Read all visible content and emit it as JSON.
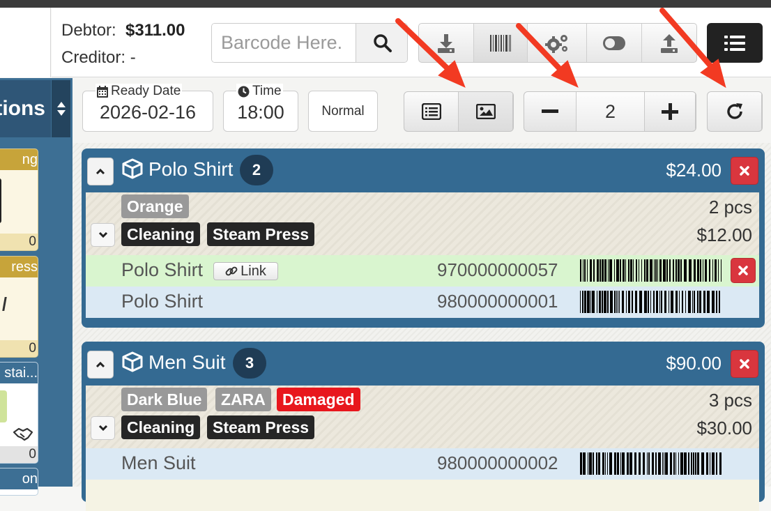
{
  "account": {
    "debtor_label": "Debtor:",
    "debtor_value": "$311.00",
    "creditor_label": "Creditor:",
    "creditor_value": "-"
  },
  "search": {
    "placeholder": "Barcode Here."
  },
  "toolbar": {
    "buttons": [
      "download-icon",
      "barcode-icon",
      "gears-icon",
      "toggle-icon",
      "upload-icon"
    ],
    "menu_icon": "list-icon"
  },
  "sidebar": {
    "header_label": "tions",
    "cards": [
      {
        "header": "ng",
        "footer": "0",
        "header_color": "#c7a43a"
      },
      {
        "header": "ress",
        "footer": "0",
        "header_color": "#c7a43a"
      },
      {
        "header": "stai...",
        "footer": "0",
        "header_color": "#3d6f94"
      },
      {
        "header": "on",
        "footer": "",
        "header_color": "#3d6f94"
      }
    ]
  },
  "order": {
    "ready_date_label": "Ready Date",
    "ready_date": "2026-02-16",
    "time_label": "Time",
    "time": "18:00",
    "priority": "Normal",
    "label_copies": "2"
  },
  "items": [
    {
      "name": "Polo Shirt",
      "qty": "2",
      "total": "$24.00",
      "tags_row1": [
        {
          "text": "Orange",
          "style": "grey"
        }
      ],
      "tags_row2": [
        {
          "text": "Cleaning",
          "style": "dark"
        },
        {
          "text": "Steam Press",
          "style": "dark"
        }
      ],
      "pcs": "2 pcs",
      "unit_price": "$12.00",
      "pieces": [
        {
          "name": "Polo Shirt",
          "link": "Link",
          "code": "970000000057",
          "bg": "#d9f5cf"
        },
        {
          "name": "Polo Shirt",
          "code": "980000000001",
          "bg": "#dbe9f4"
        }
      ]
    },
    {
      "name": "Men Suit",
      "qty": "3",
      "total": "$90.00",
      "tags_row1": [
        {
          "text": "Dark Blue",
          "style": "grey"
        },
        {
          "text": "ZARA",
          "style": "grey"
        },
        {
          "text": "Damaged",
          "style": "red"
        }
      ],
      "tags_row2": [
        {
          "text": "Cleaning",
          "style": "dark"
        },
        {
          "text": "Steam Press",
          "style": "dark"
        }
      ],
      "pcs": "3 pcs",
      "unit_price": "$30.00",
      "pieces": [
        {
          "name": "Men Suit",
          "code": "980000000002",
          "bg": "#dbe9f4"
        }
      ]
    }
  ],
  "colors": {
    "primary": "#346a92",
    "danger": "#d9363e",
    "annotation_arrow": "#f23a22"
  }
}
